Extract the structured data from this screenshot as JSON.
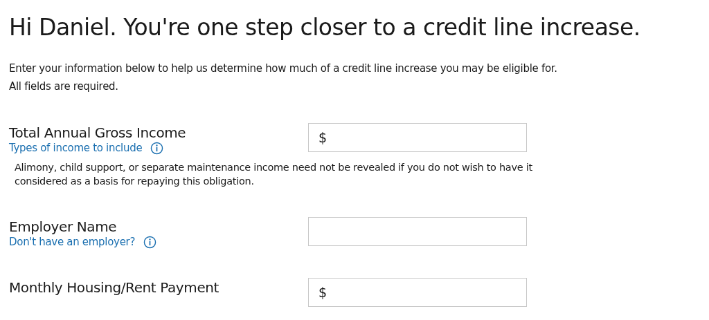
{
  "heading": "Hi Daniel. You're one step closer to a credit line increase.",
  "intro": [
    "Enter your information below to help us determine how much of a credit line increase you may be eligible for.",
    "All fields are required."
  ],
  "fields": [
    {
      "label": "Total Annual Gross Income",
      "link": "Types of income to include",
      "note": "Alimony, child support, or separate maintenance income need not be revealed if you do not wish to have it considered as a basis for repaying this obligation.",
      "prefix": "$"
    },
    {
      "label": "Employer Name",
      "link": "Don't have an employer?"
    },
    {
      "label": "Monthly Housing/Rent Payment",
      "prefix": "$"
    }
  ]
}
